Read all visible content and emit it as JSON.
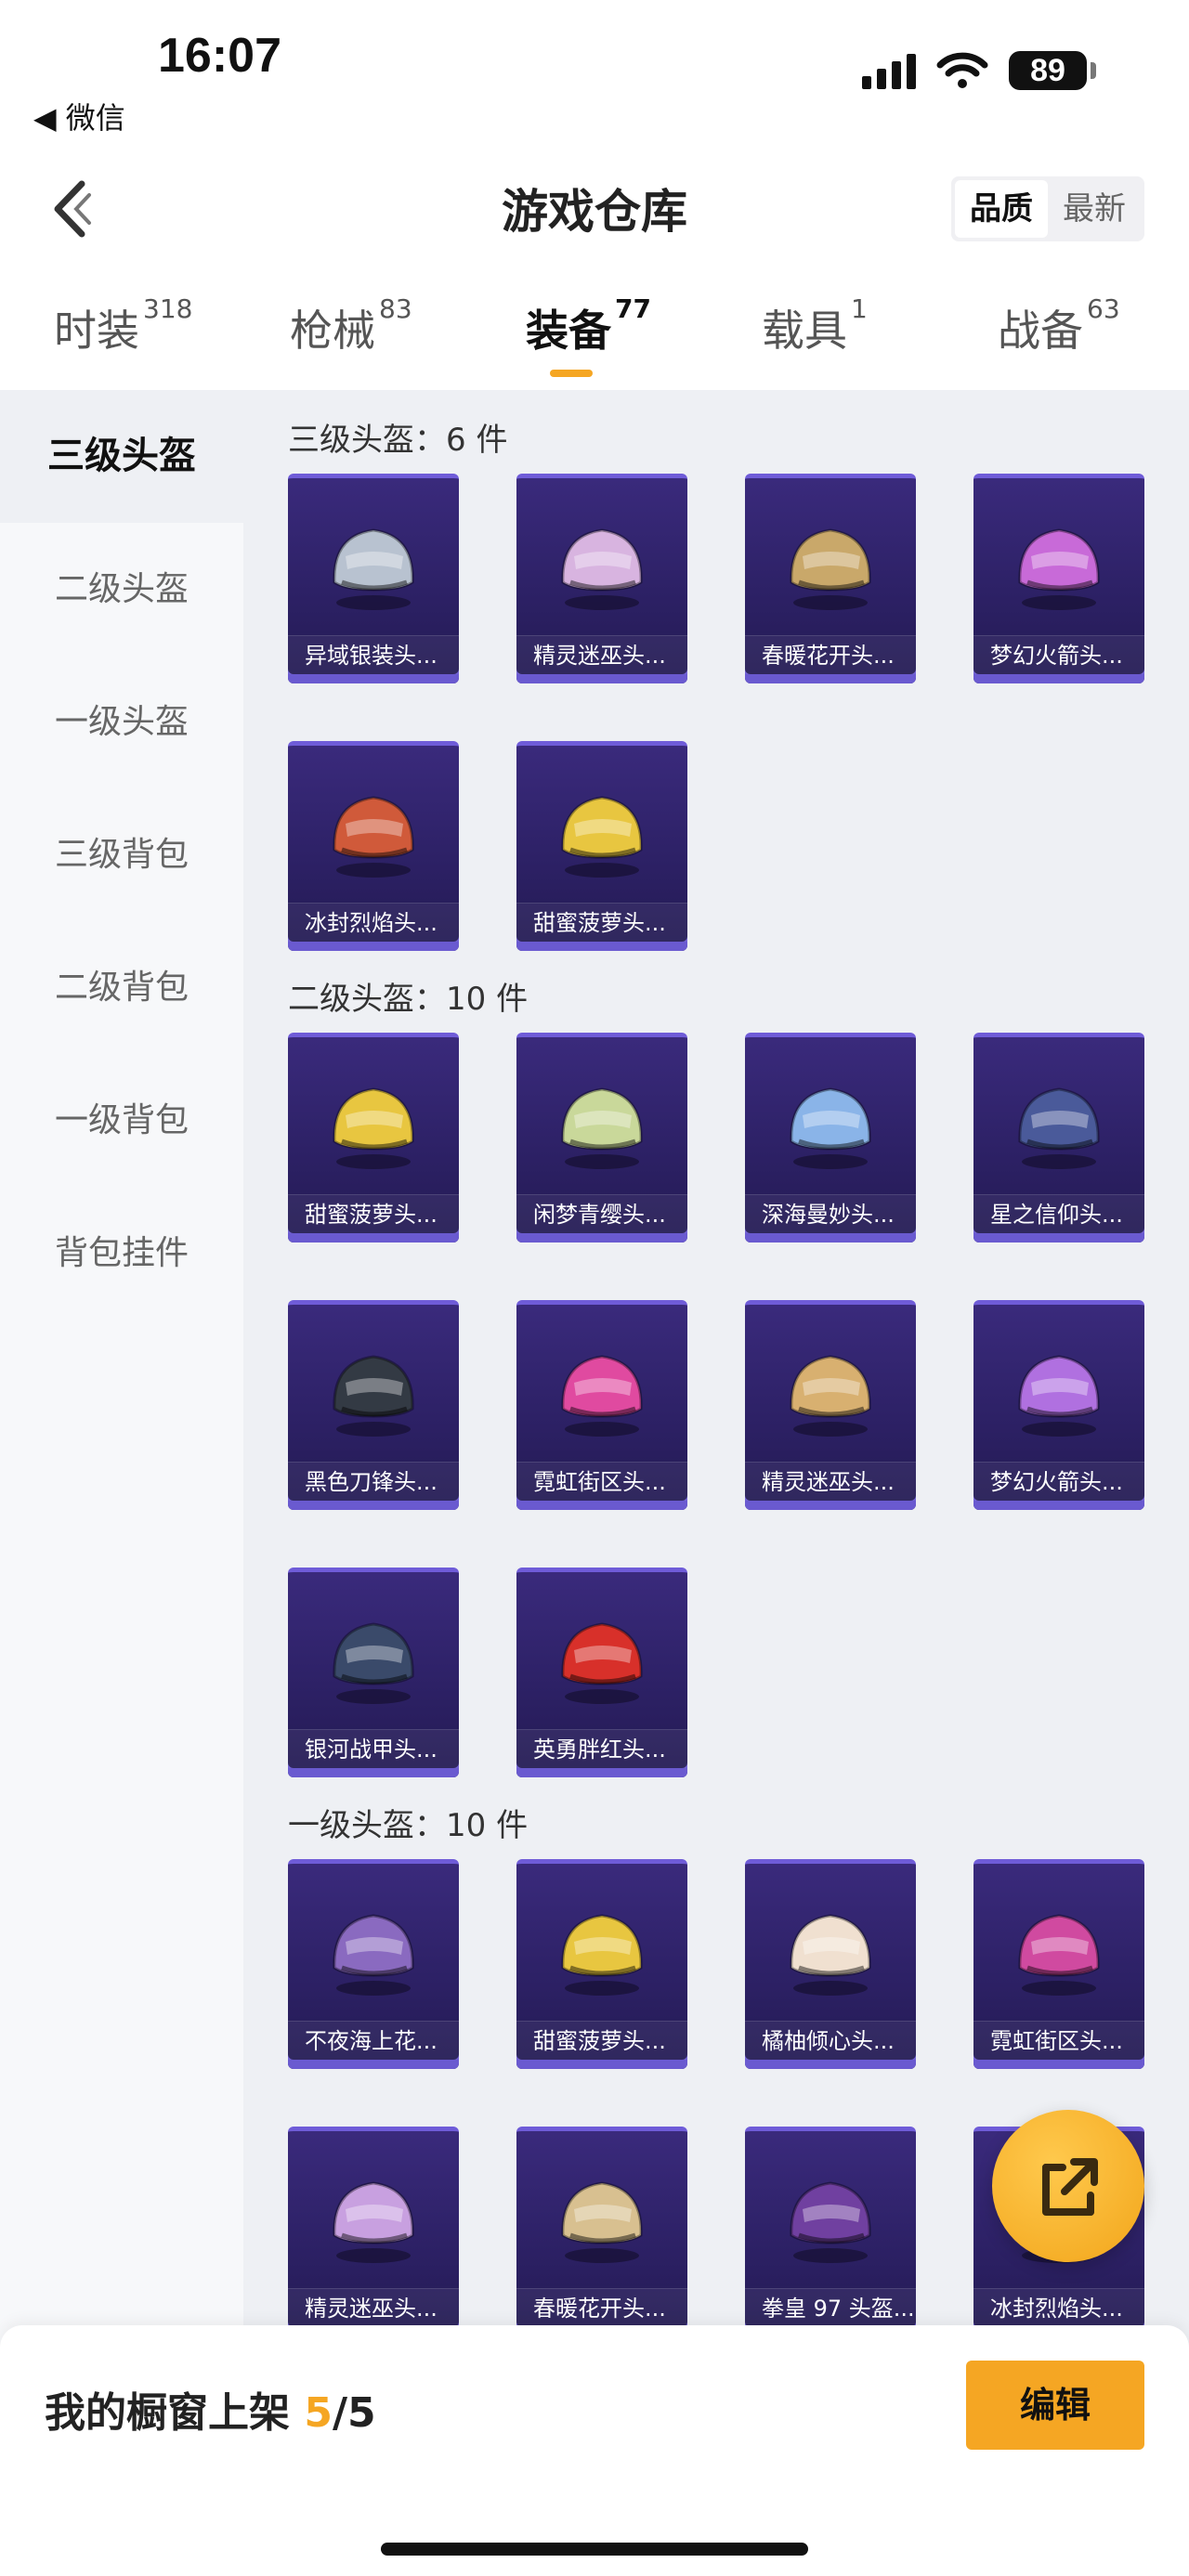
{
  "status": {
    "time": "16:07",
    "back_app": "◀ 微信",
    "battery": "89"
  },
  "header": {
    "title": "游戏仓库",
    "sort": [
      "品质",
      "最新"
    ]
  },
  "tabs": [
    {
      "label": "时装",
      "count": "318"
    },
    {
      "label": "枪械",
      "count": "83"
    },
    {
      "label": "装备",
      "count": "77"
    },
    {
      "label": "载具",
      "count": "1"
    },
    {
      "label": "战备",
      "count": "63"
    }
  ],
  "sidebar": [
    "三级头盔",
    "二级头盔",
    "一级头盔",
    "三级背包",
    "二级背包",
    "一级背包",
    "背包挂件"
  ],
  "sections": [
    {
      "title": "三级头盔：6 件",
      "items": [
        "异域银装头...",
        "精灵迷巫头...",
        "春暖花开头...",
        "梦幻火箭头...",
        "冰封烈焰头...",
        "甜蜜菠萝头..."
      ]
    },
    {
      "title": "二级头盔：10 件",
      "items": [
        "甜蜜菠萝头...",
        "闲梦青缨头...",
        "深海曼妙头...",
        "星之信仰头...",
        "黑色刀锋头...",
        "霓虹街区头...",
        "精灵迷巫头...",
        "梦幻火箭头...",
        "银河战甲头...",
        "英勇胖红头..."
      ]
    },
    {
      "title": "一级头盔：10 件",
      "items": [
        "不夜海上花...",
        "甜蜜菠萝头...",
        "橘柚倾心头...",
        "霓虹街区头...",
        "精灵迷巫头...",
        "春暖花开头...",
        "拳皇 97 头盔...",
        "冰封烈焰头..."
      ]
    }
  ],
  "helmet_colors": [
    [
      "#b8c2d0",
      "#d8b4e0",
      "#c9a86a",
      "#c86ad8",
      "#d05a3a",
      "#e8c640"
    ],
    [
      "#e8c640",
      "#c9d89a",
      "#8ab4e8",
      "#4a5a9a",
      "#333a44",
      "#e04aa0",
      "#d8b070",
      "#b070e0",
      "#3a4a6a",
      "#d8302a"
    ],
    [
      "#8a6ac0",
      "#e8c640",
      "#f0e0d0",
      "#d04aa0",
      "#c8a0e0",
      "#d8c090",
      "#7040a0",
      "#a0d0f0"
    ]
  ],
  "bottom": {
    "label": "我的橱窗上架 ",
    "current": "5",
    "total": "/5",
    "edit": "编辑"
  }
}
